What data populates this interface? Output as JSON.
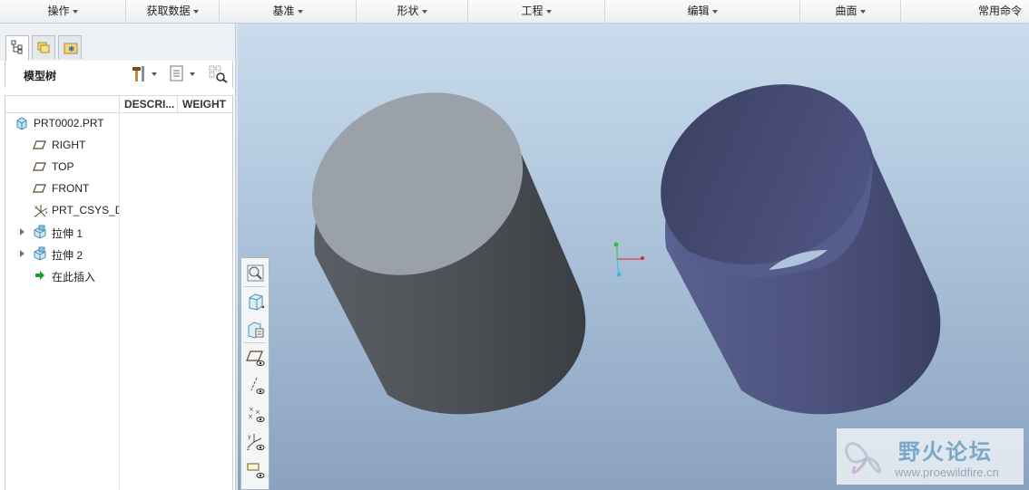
{
  "ribbon": {
    "groups": [
      {
        "label": "操作"
      },
      {
        "label": "获取数据"
      },
      {
        "label": "基准"
      },
      {
        "label": "形状"
      },
      {
        "label": "工程"
      },
      {
        "label": "编辑"
      },
      {
        "label": "曲面"
      },
      {
        "label": "常用命令"
      }
    ]
  },
  "navigator": {
    "tabs": [
      {
        "icon": "model-tree-icon"
      },
      {
        "icon": "folder-browser-icon"
      },
      {
        "icon": "favorites-icon"
      }
    ]
  },
  "model_tree": {
    "title": "模型树",
    "tool_icons": [
      "settings-hammer-icon",
      "show-list-icon",
      "filter-columns-icon"
    ],
    "columns": [
      "DESCRI...",
      "WEIGHT"
    ],
    "items": [
      {
        "label": "PRT0002.PRT",
        "icon": "part-icon",
        "expandable": false
      },
      {
        "label": "RIGHT",
        "icon": "datum-plane-icon",
        "expandable": false
      },
      {
        "label": "TOP",
        "icon": "datum-plane-icon",
        "expandable": false
      },
      {
        "label": "FRONT",
        "icon": "datum-plane-icon",
        "expandable": false
      },
      {
        "label": "PRT_CSYS_DEF",
        "icon": "csys-icon",
        "expandable": false
      },
      {
        "label": "拉伸 1",
        "icon": "extrude-icon",
        "expandable": true
      },
      {
        "label": "拉伸 2",
        "icon": "extrude-icon",
        "expandable": true
      },
      {
        "label": "在此插入",
        "icon": "insert-here-arrow-icon",
        "expandable": false
      }
    ]
  },
  "view_toolbar": {
    "buttons": [
      {
        "icon": "zoom-fit-icon"
      },
      {
        "icon": "display-style-icon"
      },
      {
        "icon": "saved-views-icon"
      },
      {
        "icon": "datum-plane-display-icon"
      },
      {
        "icon": "datum-axis-display-icon"
      },
      {
        "icon": "datum-point-display-icon"
      },
      {
        "icon": "csys-display-icon"
      },
      {
        "icon": "annotation-display-icon"
      }
    ]
  },
  "watermark": {
    "title": "野火论坛",
    "url": "www.proewildfire.cn"
  },
  "colors": {
    "solid_cylinder_top": "#9aa1a9",
    "solid_cylinder_body": "#4a4f55",
    "hollow_cylinder_body": "#4a5078",
    "viewport_top": "#c9dcee",
    "viewport_bottom": "#8aa2c0",
    "axis_x": "#e0252a",
    "axis_y": "#2fbf3a",
    "axis_z": "#3bb8e0"
  }
}
